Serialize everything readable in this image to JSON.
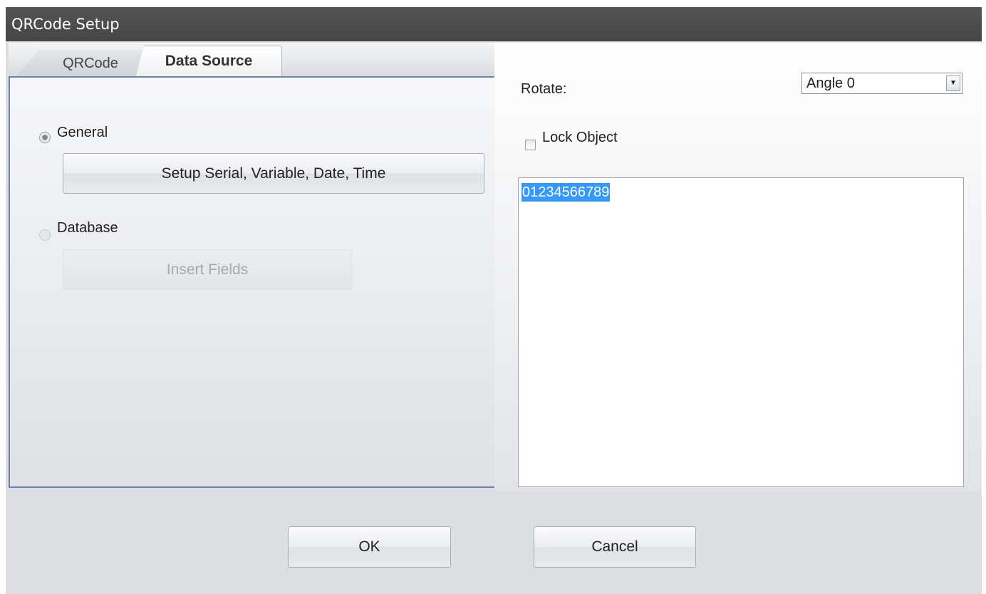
{
  "window": {
    "title": "QRCode Setup"
  },
  "tabs": [
    {
      "label": "QRCode",
      "active": false
    },
    {
      "label": "Data Source",
      "active": true
    }
  ],
  "data_source": {
    "general": {
      "label": "General",
      "checked": true
    },
    "setup_button": "Setup Serial, Variable, Date, Time",
    "database": {
      "label": "Database",
      "checked": false,
      "disabled": true
    },
    "insert_fields_button": "Insert Fields"
  },
  "rotate": {
    "label": "Rotate:",
    "value": "Angle 0"
  },
  "lock_object": {
    "label": "Lock Object",
    "checked": false
  },
  "content": {
    "text": "01234566789",
    "selected": true
  },
  "buttons": {
    "ok": "OK",
    "cancel": "Cancel"
  }
}
